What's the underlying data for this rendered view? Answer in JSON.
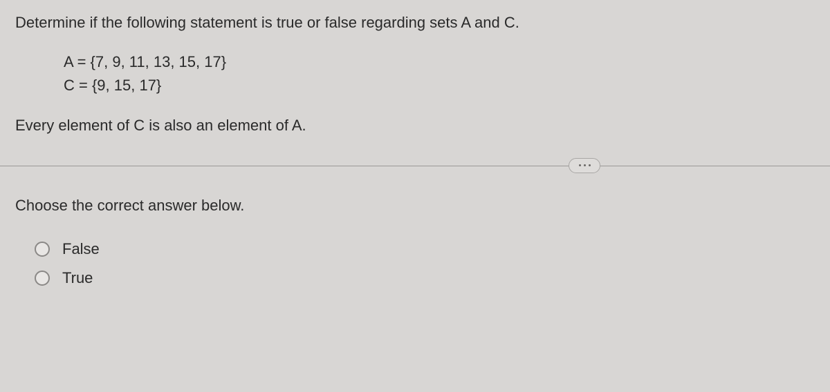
{
  "question": {
    "prompt": "Determine if the following statement is true or false regarding sets A and C.",
    "set_a": "A = {7, 9, 11, 13, 15, 17}",
    "set_c": "C = {9, 15, 17}",
    "statement": "Every element of C is also an element of A."
  },
  "answer_section": {
    "prompt": "Choose the correct answer below.",
    "options": [
      {
        "label": "False"
      },
      {
        "label": "True"
      }
    ]
  }
}
